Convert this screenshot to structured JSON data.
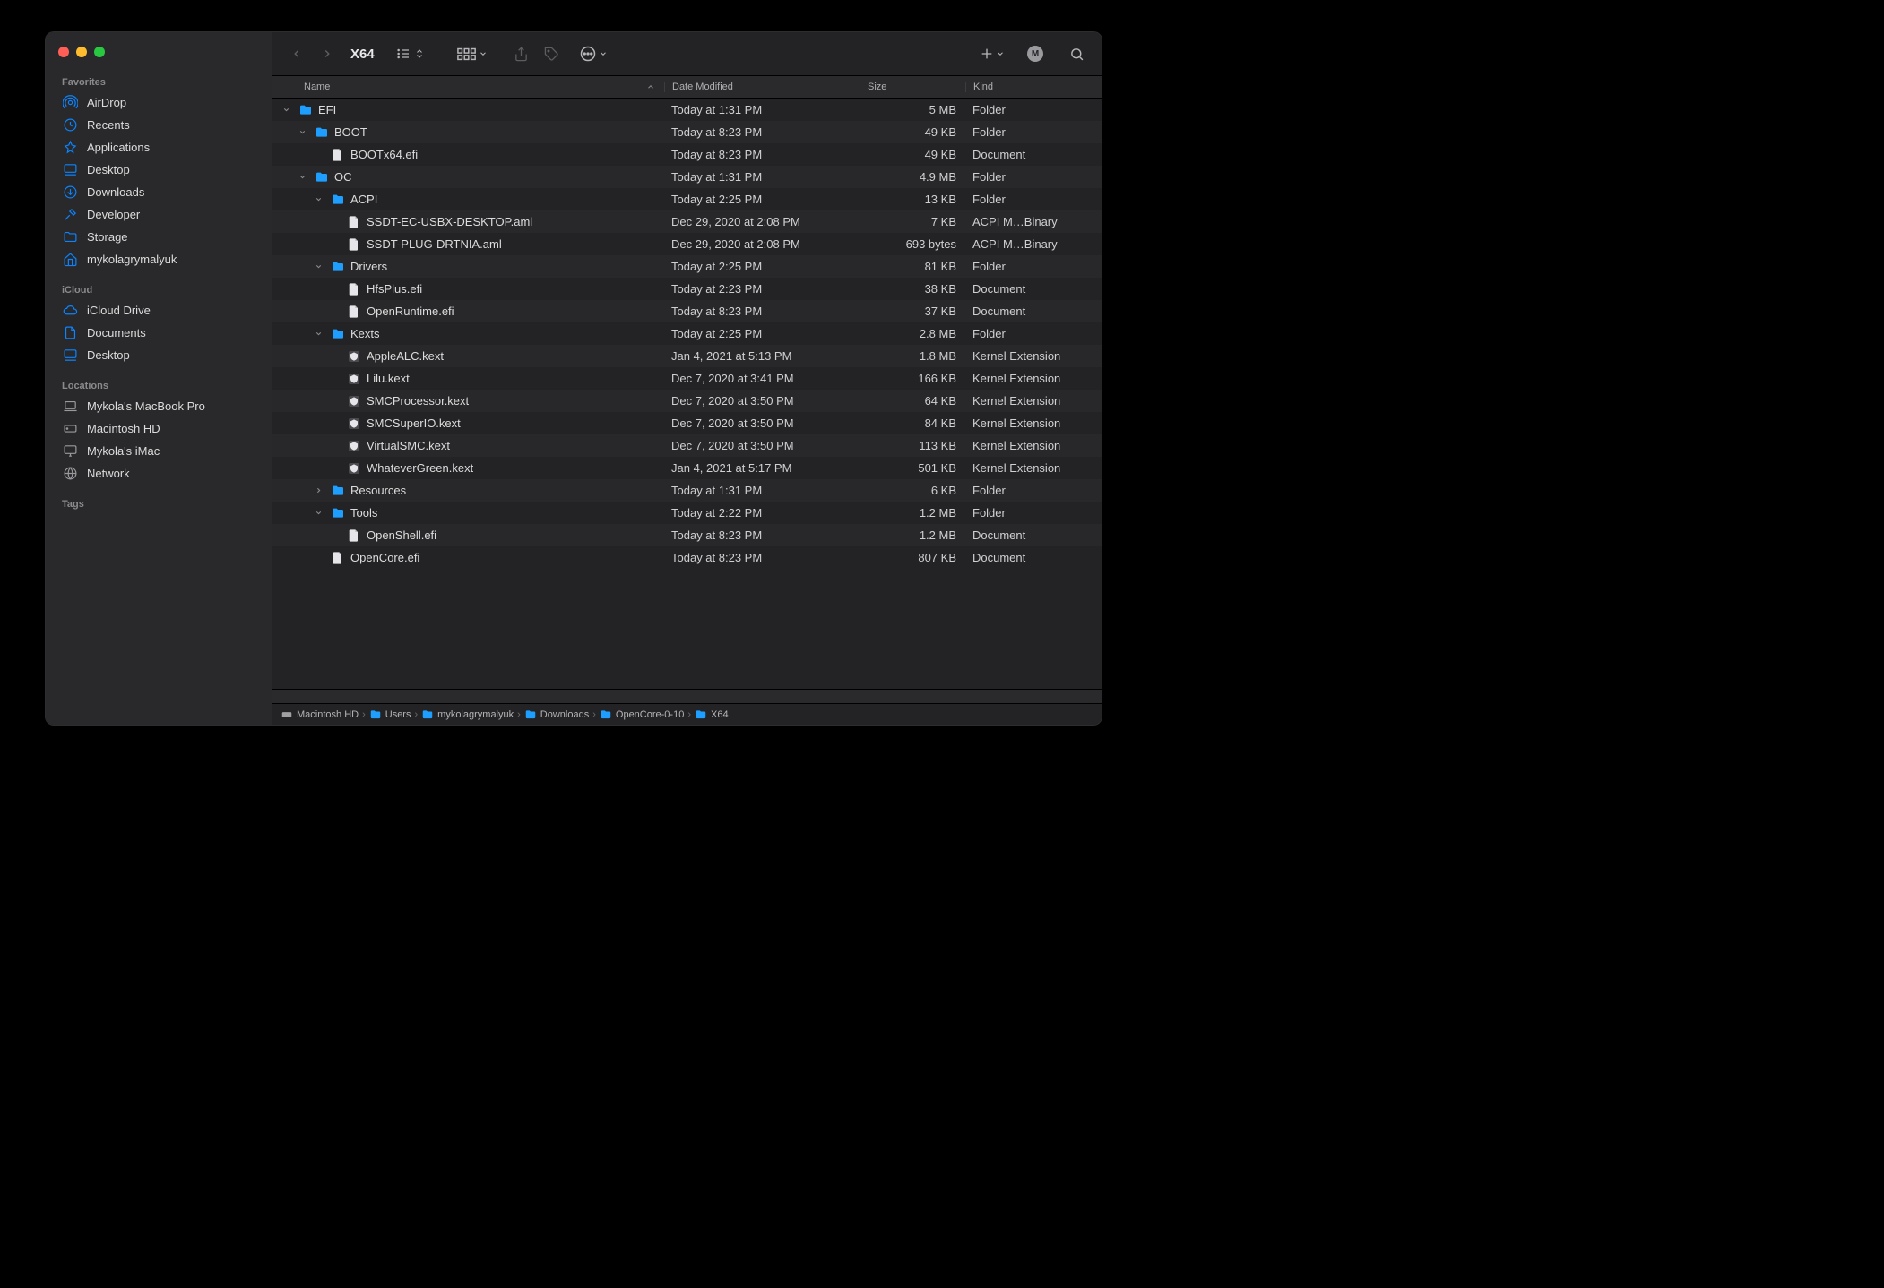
{
  "window_title": "X64",
  "sidebar": {
    "sections": [
      {
        "title": "Favorites",
        "items": [
          {
            "icon": "airdrop",
            "label": "AirDrop"
          },
          {
            "icon": "clock",
            "label": "Recents"
          },
          {
            "icon": "apps",
            "label": "Applications"
          },
          {
            "icon": "desktop",
            "label": "Desktop"
          },
          {
            "icon": "download",
            "label": "Downloads"
          },
          {
            "icon": "hammer",
            "label": "Developer"
          },
          {
            "icon": "folder",
            "label": "Storage"
          },
          {
            "icon": "house",
            "label": "mykolagrymalyuk"
          }
        ]
      },
      {
        "title": "iCloud",
        "items": [
          {
            "icon": "cloud",
            "label": "iCloud Drive"
          },
          {
            "icon": "doc",
            "label": "Documents"
          },
          {
            "icon": "desktop",
            "label": "Desktop"
          }
        ]
      },
      {
        "title": "Locations",
        "gray": true,
        "items": [
          {
            "icon": "laptop",
            "label": "Mykola's MacBook Pro"
          },
          {
            "icon": "hdd",
            "label": "Macintosh HD"
          },
          {
            "icon": "imac",
            "label": "Mykola's iMac"
          },
          {
            "icon": "globe",
            "label": "Network"
          }
        ]
      },
      {
        "title": "Tags",
        "items": []
      }
    ]
  },
  "columns": {
    "name": "Name",
    "date": "Date Modified",
    "size": "Size",
    "kind": "Kind"
  },
  "rows": [
    {
      "indent": 0,
      "chev": "down",
      "icon": "folder",
      "name": "EFI",
      "date": "Today at 1:31 PM",
      "size": "5 MB",
      "kind": "Folder"
    },
    {
      "indent": 1,
      "chev": "down",
      "icon": "folder",
      "name": "BOOT",
      "date": "Today at 8:23 PM",
      "size": "49 KB",
      "kind": "Folder"
    },
    {
      "indent": 2,
      "chev": "",
      "icon": "file",
      "name": "BOOTx64.efi",
      "date": "Today at 8:23 PM",
      "size": "49 KB",
      "kind": "Document"
    },
    {
      "indent": 1,
      "chev": "down",
      "icon": "folder",
      "name": "OC",
      "date": "Today at 1:31 PM",
      "size": "4.9 MB",
      "kind": "Folder"
    },
    {
      "indent": 2,
      "chev": "down",
      "icon": "folder",
      "name": "ACPI",
      "date": "Today at 2:25 PM",
      "size": "13 KB",
      "kind": "Folder"
    },
    {
      "indent": 3,
      "chev": "",
      "icon": "file",
      "name": "SSDT-EC-USBX-DESKTOP.aml",
      "date": "Dec 29, 2020 at 2:08 PM",
      "size": "7 KB",
      "kind": "ACPI M…Binary"
    },
    {
      "indent": 3,
      "chev": "",
      "icon": "file",
      "name": "SSDT-PLUG-DRTNIA.aml",
      "date": "Dec 29, 2020 at 2:08 PM",
      "size": "693 bytes",
      "kind": "ACPI M…Binary"
    },
    {
      "indent": 2,
      "chev": "down",
      "icon": "folder",
      "name": "Drivers",
      "date": "Today at 2:25 PM",
      "size": "81 KB",
      "kind": "Folder"
    },
    {
      "indent": 3,
      "chev": "",
      "icon": "file",
      "name": "HfsPlus.efi",
      "date": "Today at 2:23 PM",
      "size": "38 KB",
      "kind": "Document"
    },
    {
      "indent": 3,
      "chev": "",
      "icon": "file",
      "name": "OpenRuntime.efi",
      "date": "Today at 8:23 PM",
      "size": "37 KB",
      "kind": "Document"
    },
    {
      "indent": 2,
      "chev": "down",
      "icon": "folder",
      "name": "Kexts",
      "date": "Today at 2:25 PM",
      "size": "2.8 MB",
      "kind": "Folder"
    },
    {
      "indent": 3,
      "chev": "",
      "icon": "kext",
      "name": "AppleALC.kext",
      "date": "Jan 4, 2021 at 5:13 PM",
      "size": "1.8 MB",
      "kind": "Kernel Extension"
    },
    {
      "indent": 3,
      "chev": "",
      "icon": "kext",
      "name": "Lilu.kext",
      "date": "Dec 7, 2020 at 3:41 PM",
      "size": "166 KB",
      "kind": "Kernel Extension"
    },
    {
      "indent": 3,
      "chev": "",
      "icon": "kext",
      "name": "SMCProcessor.kext",
      "date": "Dec 7, 2020 at 3:50 PM",
      "size": "64 KB",
      "kind": "Kernel Extension"
    },
    {
      "indent": 3,
      "chev": "",
      "icon": "kext",
      "name": "SMCSuperIO.kext",
      "date": "Dec 7, 2020 at 3:50 PM",
      "size": "84 KB",
      "kind": "Kernel Extension"
    },
    {
      "indent": 3,
      "chev": "",
      "icon": "kext",
      "name": "VirtualSMC.kext",
      "date": "Dec 7, 2020 at 3:50 PM",
      "size": "113 KB",
      "kind": "Kernel Extension"
    },
    {
      "indent": 3,
      "chev": "",
      "icon": "kext",
      "name": "WhateverGreen.kext",
      "date": "Jan 4, 2021 at 5:17 PM",
      "size": "501 KB",
      "kind": "Kernel Extension"
    },
    {
      "indent": 2,
      "chev": "right",
      "icon": "folder",
      "name": "Resources",
      "date": "Today at 1:31 PM",
      "size": "6 KB",
      "kind": "Folder"
    },
    {
      "indent": 2,
      "chev": "down",
      "icon": "folder",
      "name": "Tools",
      "date": "Today at 2:22 PM",
      "size": "1.2 MB",
      "kind": "Folder"
    },
    {
      "indent": 3,
      "chev": "",
      "icon": "file",
      "name": "OpenShell.efi",
      "date": "Today at 8:23 PM",
      "size": "1.2 MB",
      "kind": "Document"
    },
    {
      "indent": 2,
      "chev": "",
      "icon": "file",
      "name": "OpenCore.efi",
      "date": "Today at 8:23 PM",
      "size": "807 KB",
      "kind": "Document"
    }
  ],
  "pathbar": [
    {
      "icon": "hdd",
      "label": "Macintosh HD"
    },
    {
      "icon": "folder",
      "label": "Users"
    },
    {
      "icon": "folder",
      "label": "mykolagrymalyuk"
    },
    {
      "icon": "folder",
      "label": "Downloads"
    },
    {
      "icon": "folder",
      "label": "OpenCore-0-10"
    },
    {
      "icon": "folder",
      "label": "X64"
    }
  ]
}
